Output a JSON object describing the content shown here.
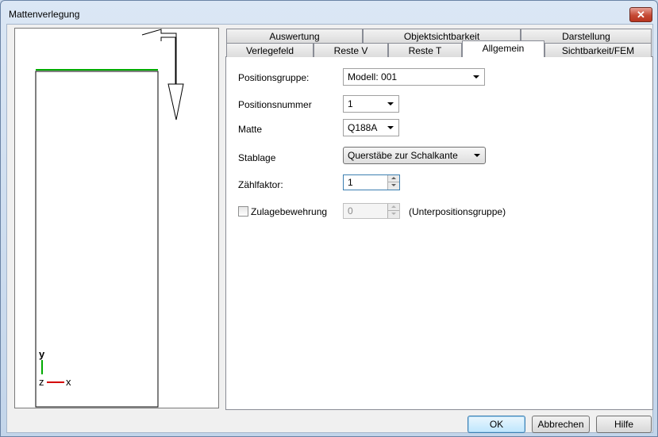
{
  "window": {
    "title": "Mattenverlegung",
    "close_glyph": "✕"
  },
  "preview": {
    "axis_y": "y",
    "axis_z": "z",
    "axis_x": "x",
    "colors": {
      "line": "#00aa00",
      "axis_x": "#d40000"
    }
  },
  "tabs": {
    "row_back": [
      "Auswertung",
      "Objektsichtbarkeit",
      "Darstellung"
    ],
    "row_front": [
      "Verlegefeld",
      "Reste V",
      "Reste T",
      "Allgemein",
      "Sichtbarkeit/FEM"
    ],
    "active": "Allgemein"
  },
  "form": {
    "positionsgruppe": {
      "label": "Positionsgruppe:",
      "value": "Modell: 001"
    },
    "positionsnummer": {
      "label": "Positionsnummer",
      "value": "1"
    },
    "matte": {
      "label": "Matte",
      "value": "Q188A"
    },
    "stablage": {
      "label": "Stablage",
      "value": "Querstäbe zur Schalkante"
    },
    "zaehlfaktor": {
      "label": "Zählfaktor:",
      "value": "1"
    },
    "zulage": {
      "label": "Zulagebewehrung",
      "value": "0",
      "suffix": "(Unterpositionsgruppe)",
      "checked": false
    }
  },
  "buttons": {
    "ok": "OK",
    "cancel": "Abbrechen",
    "help": "Hilfe"
  }
}
